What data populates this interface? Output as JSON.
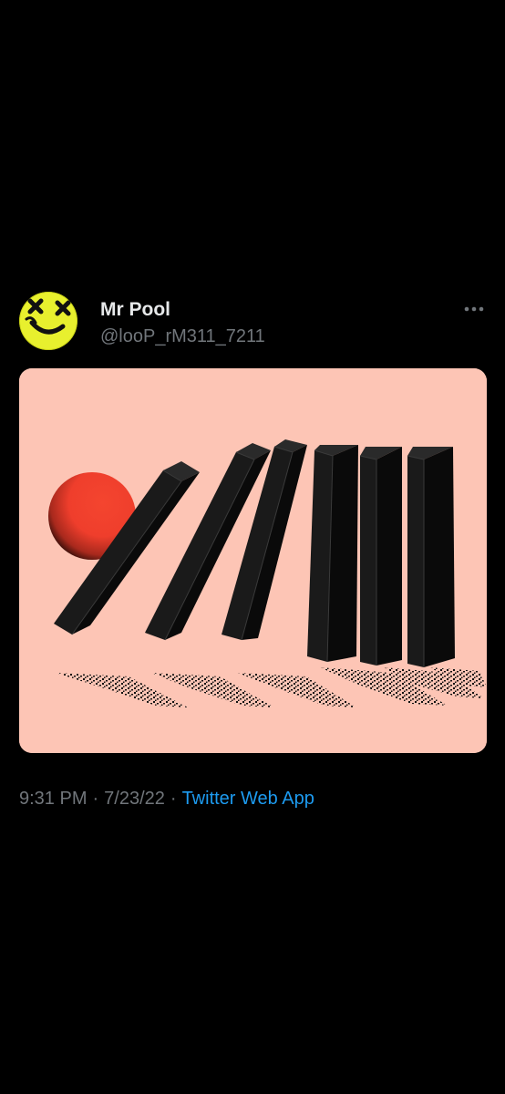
{
  "tweet": {
    "author": {
      "display_name": "Mr Pool",
      "handle": "@looP_rM311_7211",
      "avatar_icon": "yellow-dead-smiley-avatar"
    },
    "more_icon": "more-dots-icon",
    "media": {
      "alt": "",
      "background_color": "#fdc5b5",
      "ball_color": "#ef3e2c"
    },
    "time": "9:31 PM",
    "separator": "·",
    "date": "7/23/22",
    "source": "Twitter Web App"
  },
  "colors": {
    "background": "#000000",
    "primary_text": "#e7e9ea",
    "secondary_text": "#71767b",
    "link": "#1d9bf0"
  }
}
